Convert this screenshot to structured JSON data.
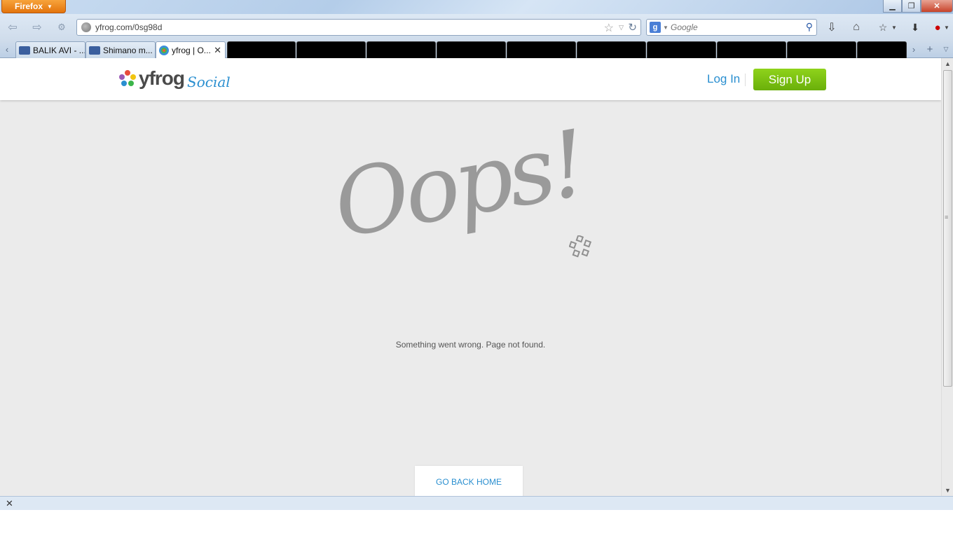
{
  "browser": {
    "menu_label": "Firefox",
    "url": "yfrog.com/0sg98d",
    "search_placeholder": "Google",
    "tabs": [
      {
        "label": "BALIK AVI - ..."
      },
      {
        "label": "Shimano m..."
      },
      {
        "label": "yfrog | O..."
      }
    ]
  },
  "site": {
    "brand": "yfrog",
    "brand_suffix": "Social",
    "login_label": "Log In",
    "signup_label": "Sign Up",
    "headline": "Oops!",
    "message": "Something went wrong. Page not found.",
    "home_label": "GO BACK HOME"
  },
  "colors": {
    "accent_blue": "#2a8fd0",
    "signup_green": "#7bc212",
    "page_bg": "#ebebeb"
  }
}
